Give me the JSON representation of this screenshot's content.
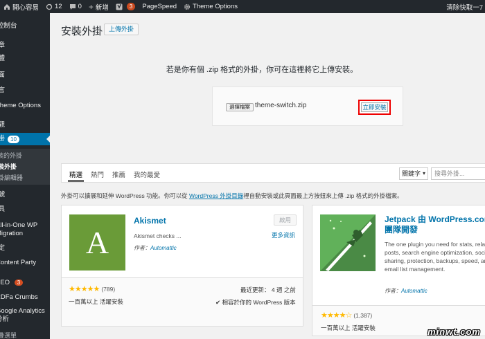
{
  "admin_bar": {
    "site_name": "開心容易",
    "updates": "12",
    "comments": "0",
    "new": "新增",
    "yoast_count": "3",
    "pagespeed": "PageSpeed",
    "theme_options": "Theme Options",
    "right_text": "清除快取一7"
  },
  "sidebar": {
    "items": [
      {
        "label": "控制台"
      },
      {
        "label": "文章"
      },
      {
        "label": "媒體"
      },
      {
        "label": "頁面"
      },
      {
        "label": "留言"
      },
      {
        "label": "Theme Options"
      },
      {
        "label": "外觀"
      },
      {
        "label": "外掛",
        "count": "10"
      },
      {
        "label": "已安裝的外掛"
      },
      {
        "label": "安裝外掛"
      },
      {
        "label": "外掛編輯器"
      },
      {
        "label": "帳號"
      },
      {
        "label": "工具"
      },
      {
        "label": "All-in-One WP Migration"
      },
      {
        "label": "設定"
      },
      {
        "label": "Content Party"
      },
      {
        "label": "SEO",
        "count": "3"
      },
      {
        "label": "RDFa Crumbs"
      },
      {
        "label": "Google Analytics 分析"
      },
      {
        "label": "摺疊選單"
      }
    ]
  },
  "page": {
    "title": "安裝外掛",
    "upload_button": "上傳外掛"
  },
  "upload": {
    "description": "若是你有個 .zip 格式的外掛，你可在這裡將它上傳安裝。",
    "choose_file": "選擇檔案",
    "file_name": "theme-switch.zip",
    "install_now": "立即安裝"
  },
  "filter": {
    "tabs": [
      "精選",
      "熱門",
      "推薦",
      "我的最愛"
    ],
    "search_type": "關鍵字",
    "search_placeholder": "搜尋外掛..."
  },
  "notice": {
    "before": "外掛可以擴展和延伸 WordPress 功能。你可以從 ",
    "link": "WordPress 外掛目錄",
    "after": "裡自動安裝或此頁面最上方按鈕來上傳 .zip 格式的外掛檔案。"
  },
  "plugins": [
    {
      "name": "Akismet",
      "icon_letter": "A",
      "description": "Akismet checks ...",
      "author_label": "作者：",
      "author": "Automattic",
      "button": "啟用",
      "more": "更多資訊",
      "stars": "★★★★★",
      "rating_count": "(789)",
      "installs": "一百萬以上 活躍安裝",
      "last_updated": "最近更新： 4 週 之前",
      "compatible": "✔ 相容於你的 WordPress 版本"
    },
    {
      "name": "Jetpack 由 WordPress.com 團隊開發",
      "description": "The one plugin you need for stats, related posts, search engine optimization, social sharing, protection, backups, speed, and email list management.",
      "author_label": "作者：",
      "author": "Automattic",
      "stars": "★★★★☆",
      "rating_count": "(1,387)",
      "installs": "一百萬以上 活躍安裝"
    }
  ],
  "watermark": "minwt.com"
}
